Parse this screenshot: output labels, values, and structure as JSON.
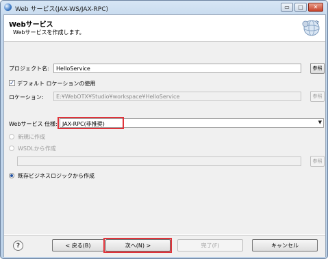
{
  "window": {
    "title": "Web サービス(JAX-WS/JAX-RPC)",
    "controls": {
      "minimize": "▭",
      "maximize": "□",
      "close": "✕"
    }
  },
  "banner": {
    "title": "Webサービス",
    "description": "Webサービスを作成します。"
  },
  "form": {
    "project_label": "プロジェクト名:",
    "project_value": "HelloService",
    "browse_label": "参照",
    "default_location_label": "デフォルト ロケーションの使用",
    "default_location_checked": true,
    "location_label": "ロケーション:",
    "location_value": "E:¥WebOTX¥Studio¥workspace¥HelloService",
    "spec_label": "Webサービス 仕様:",
    "spec_value": "JAX-RPC(非推奨)",
    "radio_new": "新規に作成",
    "radio_wsdl": "WSDLから作成",
    "wsdl_path_value": "",
    "radio_existing": "既存ビジネスロジックから作成",
    "selected_radio": "existing"
  },
  "footer": {
    "help_label": "?",
    "back_label": "< 戻る(B)",
    "next_label": "次へ(N) >",
    "finish_label": "完了(F)",
    "cancel_label": "キャンセル"
  },
  "colors": {
    "highlight": "#e0333a",
    "accent": "#1f4fa0"
  }
}
